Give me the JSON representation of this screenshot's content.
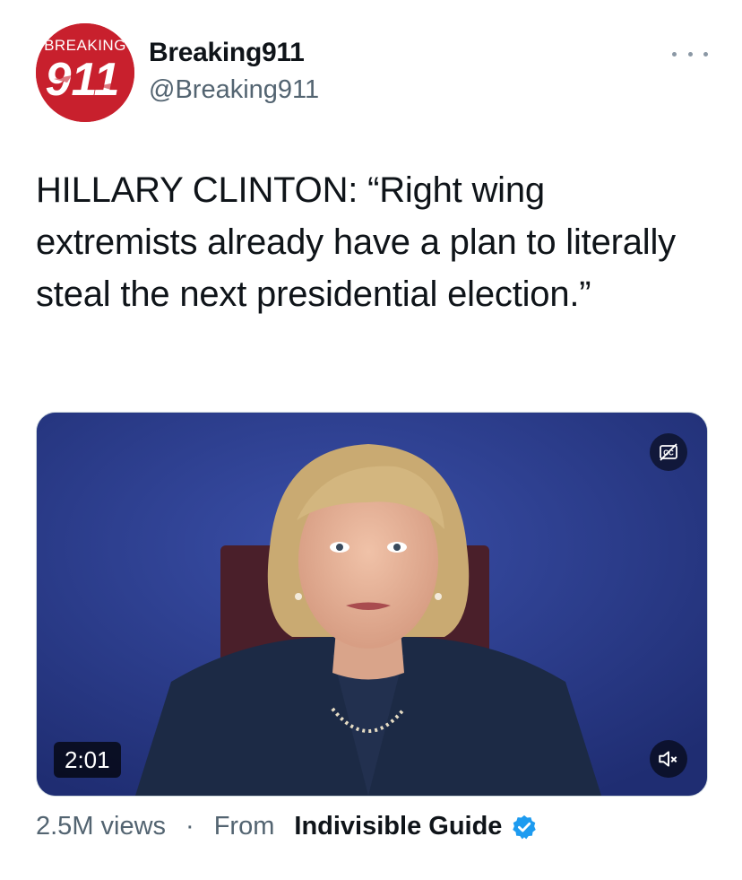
{
  "tweet": {
    "author": {
      "name": "Breaking911",
      "handle": "@Breaking911",
      "avatar_icon": "breaking911-logo-avatar",
      "avatar_logo_text": "BREAKING 911",
      "avatar_color": "#c8202d"
    },
    "more_icon": "more-dots-icon",
    "text": "HILLARY CLINTON: “Right wing extremists already have a plan to literally steal the next presidential election.”",
    "media": {
      "type": "video",
      "duration": "2:01",
      "captions_icon": "captions-off-icon",
      "mute_icon": "muted-speaker-icon",
      "background_color": "#2b3b8e"
    },
    "views": "2.5M views",
    "separator": "·",
    "from_label": "From",
    "source_name": "Indivisible Guide",
    "verified_icon": "verified-badge-icon",
    "verified_color": "#1d9bf0"
  }
}
